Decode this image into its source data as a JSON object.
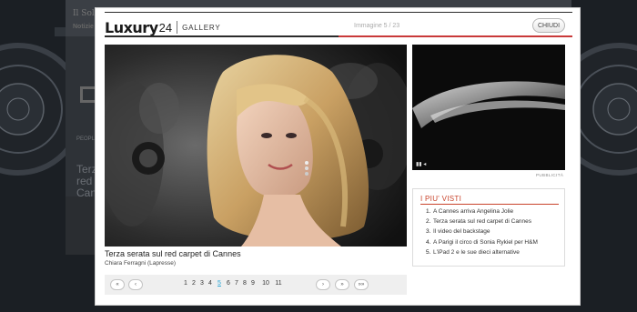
{
  "background": {
    "site_logo": "Il Sole",
    "site_tab": "Notizie",
    "section_tag": "PEOPLE",
    "headline_fragment": "Terza red Cannes"
  },
  "modal": {
    "brand_name": "Luxury",
    "brand_number": "24",
    "brand_section": "GALLERY",
    "counter": "Immagine 5 / 23",
    "close_label": "CHIUDI",
    "caption_title": "Terza serata sul red carpet di Cannes",
    "caption_credit": "Chiara Ferragni (Lapresse)",
    "pager": {
      "first": "«",
      "prev": "‹",
      "next": "›",
      "last": "»",
      "next_group": "»»",
      "pages": [
        "1",
        "2",
        "3",
        "4",
        "5",
        "6",
        "7",
        "8",
        "9",
        "10",
        "11"
      ],
      "current": "5"
    },
    "video": {
      "play_pause": "▮▮ ◂",
      "ad_label": "PUBBLICITÀ"
    },
    "popular": {
      "title": "I PIU' VISTI",
      "items": [
        {
          "num": "1.",
          "label": "A Cannes arriva Angelina Jolie"
        },
        {
          "num": "2.",
          "label": "Terza serata sul red carpet di Cannes"
        },
        {
          "num": "3.",
          "label": "Il video del backstage"
        },
        {
          "num": "4.",
          "label": "A Parigi il circo di Sonia Rykiel per H&M"
        },
        {
          "num": "5.",
          "label": "L'iPad 2 e le sue dieci alternative"
        }
      ]
    }
  },
  "colors": {
    "accent_red": "#c8432b",
    "active_page": "#2aa6d6"
  }
}
